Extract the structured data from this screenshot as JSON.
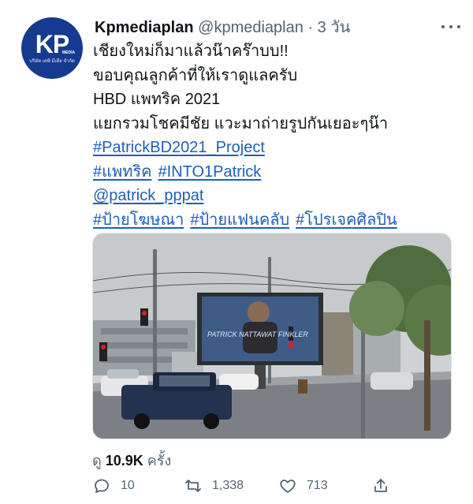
{
  "tweet": {
    "avatar": {
      "logo_text": "KP",
      "logo_tag": "MEDIA",
      "logo_subtitle": "บริษัท เคพี มีเดีย จำกัด"
    },
    "author_name": "Kpmediaplan",
    "author_handle": "@kpmediaplan",
    "separator": "·",
    "timestamp": "3 วัน",
    "text_lines": [
      "เชียงใหม่ก็มาแล้วน๊าคร๊าบบ!!",
      "ขอบคุณลูกค้าที่ให้เราดูแลครับ",
      "HBD แพทริค 2021",
      "แยกรวมโชคมีชัย แวะมาถ่ายรูปกันเยอะๆน๊า"
    ],
    "hashtag_project": "#PatrickBD2021_Project",
    "hashtag_patrick_thai": "#แพทริค",
    "hashtag_into1": "#INTO1Patrick",
    "mention": "@patrick_pppat",
    "hashtag_billboard": "#ป้ายโฆษณา",
    "hashtag_fan_billboard": "#ป้ายแฟนคลับ",
    "hashtag_artist_project": "#โปรเจคศิลปิน",
    "billboard_text": "PATRICK NATTAWAT FINKLER",
    "views_prefix": "ดู",
    "views_count": "10.9K",
    "views_suffix": "ครั้ง",
    "replies": "10",
    "retweets": "1,338",
    "likes": "713"
  },
  "colors": {
    "link": "#1d5fb8",
    "secondary_text": "#536471",
    "avatar_bg": "#163a8f"
  },
  "icons": [
    "more-icon",
    "reply-icon",
    "retweet-icon",
    "like-icon",
    "share-icon"
  ]
}
